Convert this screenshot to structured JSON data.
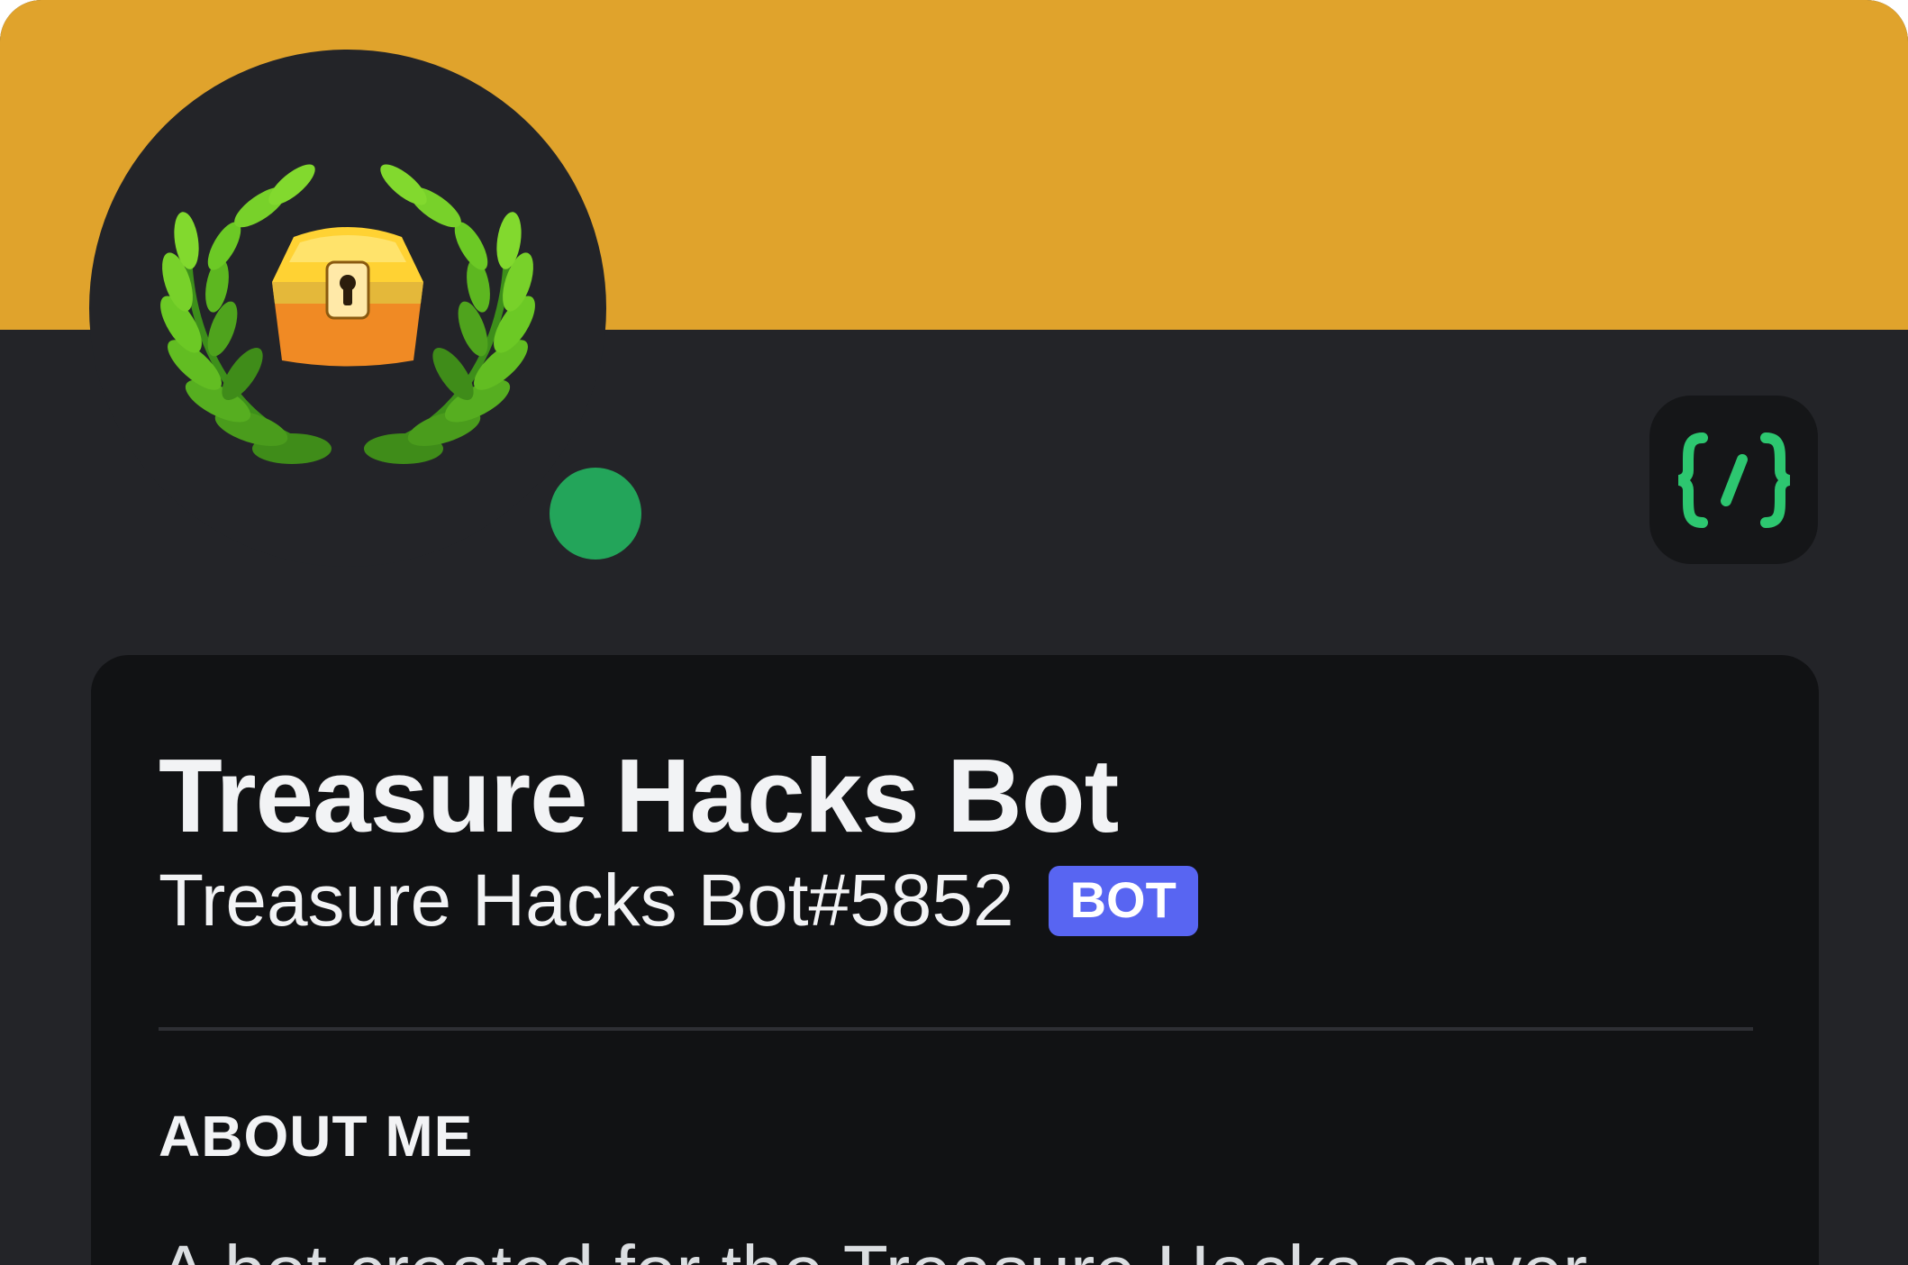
{
  "profile": {
    "display_name": "Treasure Hacks Bot",
    "username": "Treasure Hacks Bot#5852",
    "bot_tag": "BOT",
    "status": "online",
    "avatar_icon": "treasure-chest-laurel-icon",
    "dev_badge_icon": "slash-commands-icon"
  },
  "about": {
    "title": "ABOUT ME",
    "text": "A bot created for the Treasure Hacks server"
  },
  "colors": {
    "banner": "#e0a32c",
    "card_background": "#232428",
    "info_background": "#111214",
    "status_online": "#23a55a",
    "bot_tag": "#5865f2",
    "dev_badge_glyph": "#2dc770"
  }
}
